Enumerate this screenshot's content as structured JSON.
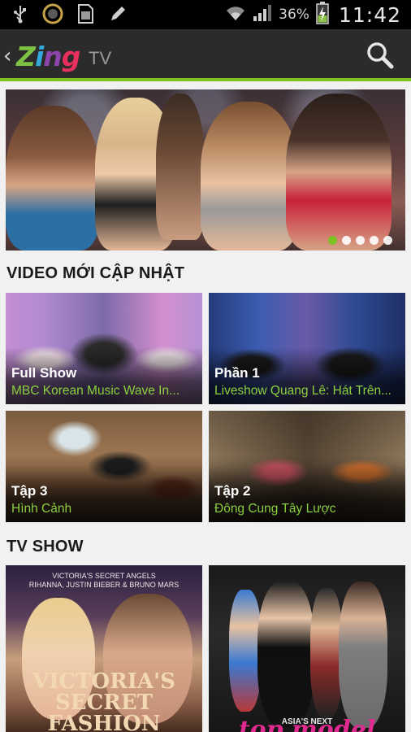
{
  "status_bar": {
    "icons": [
      "usb-icon",
      "camera-ring-icon",
      "sd-card-icon",
      "pencil-icon"
    ],
    "battery_percent": "36%",
    "time": "11:42"
  },
  "action_bar": {
    "logo_text": "Zing",
    "tv_label": "TV",
    "accent_color": "#7cc221"
  },
  "banner": {
    "slide_count": 5,
    "active_slide": 1
  },
  "sections": {
    "latest": {
      "title": "VIDEO MỚI CẬP NHẬT",
      "items": [
        {
          "episode": "Full Show",
          "title": "MBC Korean Music Wave In..."
        },
        {
          "episode": "Phần 1",
          "title": "Liveshow Quang Lê: Hát Trên..."
        },
        {
          "episode": "Tập 3",
          "title": "Hình Cảnh"
        },
        {
          "episode": "Tập 2",
          "title": "Đông Cung Tây Lược"
        }
      ]
    },
    "tv_show": {
      "title": "TV SHOW",
      "items": [
        {
          "poster_caption": "VICTORIA'S SECRET ANGELS\nRIHANNA, JUSTIN BIEBER & BRUNO MARS",
          "poster_title": "VICTORIA'S SECRET FASHION"
        },
        {
          "poster_caption": "ASIA'S NEXT",
          "poster_title": "top model"
        }
      ]
    }
  }
}
